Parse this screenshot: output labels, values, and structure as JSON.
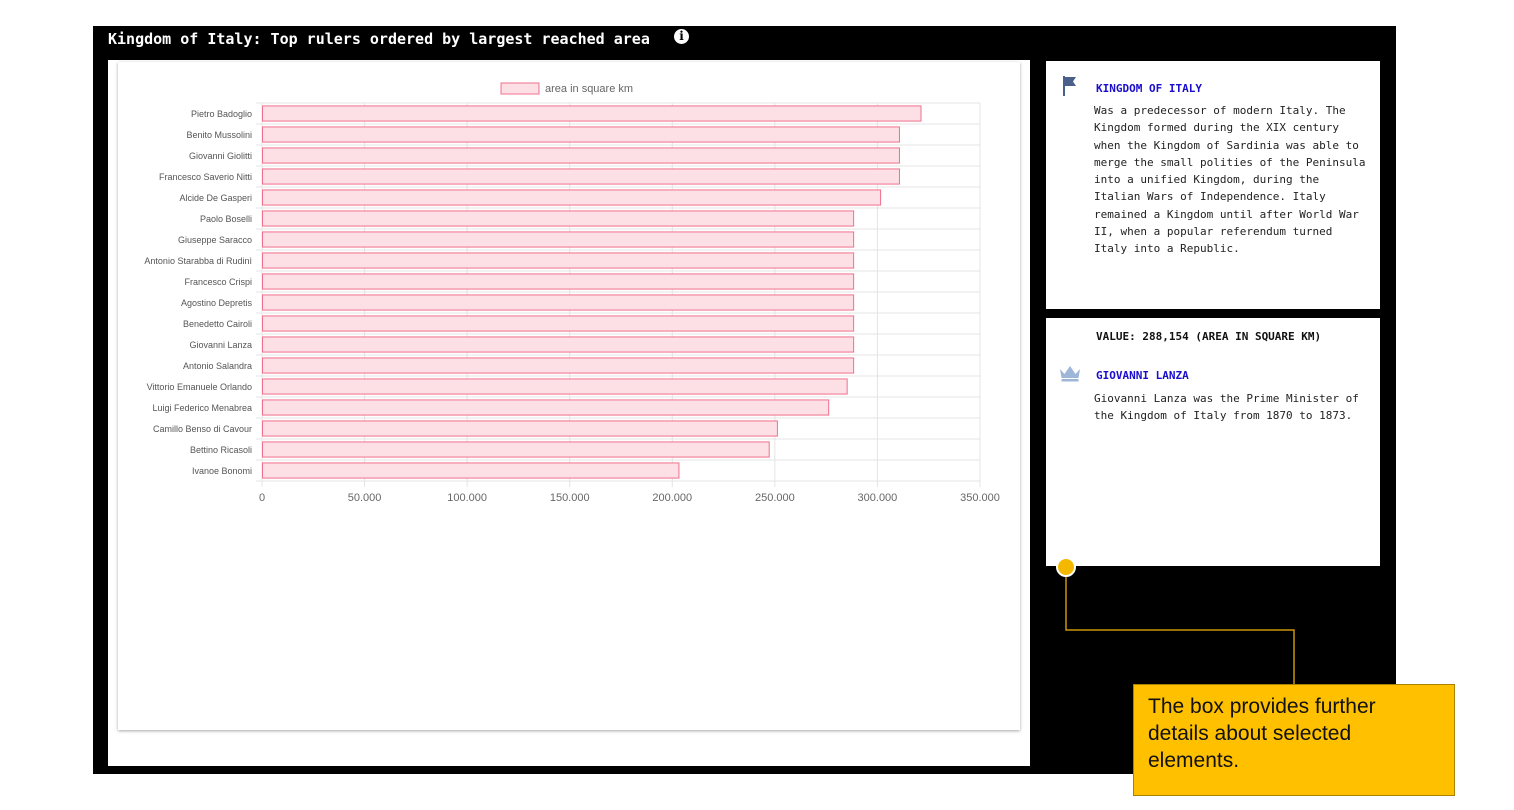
{
  "page": {
    "title": "Kingdom of Italy: Top rulers ordered by largest reached area",
    "info_icon": "info-icon"
  },
  "kingdom_panel": {
    "icon": "flag-icon",
    "heading": "KINGDOM OF ITALY",
    "description": "Was a predecessor of modern Italy. The Kingdom formed during the XIX century when the Kingdom of Sardinia was able to merge the small polities of the Peninsula into a unified Kingdom, during the Italian Wars of Independence. Italy remained a Kingdom until after World War II, when a popular referendum turned Italy into a Republic."
  },
  "detail_panel": {
    "value_text": "VALUE: 288,154 (AREA IN SQUARE KM)",
    "icon": "crown-icon",
    "heading": "GIOVANNI LANZA",
    "description": "Giovanni Lanza was the Prime Minister of the Kingdom of Italy from 1870 to 1873."
  },
  "callout": {
    "text": "The box provides further details about selected elements."
  },
  "colors": {
    "bar_fill": "#fde0e6",
    "bar_stroke": "#f0708c",
    "frame": "#000000",
    "link": "#1a0dcc",
    "callout": "#ffc000"
  },
  "chart_data": {
    "type": "bar",
    "orientation": "horizontal",
    "legend": "area in square km",
    "legend_position": "top",
    "grid": true,
    "xlim": [
      0,
      350000
    ],
    "x_ticks": [
      "0",
      "50.000",
      "100.000",
      "150.000",
      "200.000",
      "250.000",
      "300.000",
      "350.000"
    ],
    "categories": [
      "Pietro Badoglio",
      "Benito Mussolini",
      "Giovanni Giolitti",
      "Francesco Saverio Nitti",
      "Alcide De Gasperi",
      "Paolo Boselli",
      "Giuseppe Saracco",
      "Antonio Starabba di Rudinì",
      "Francesco Crispi",
      "Agostino Depretis",
      "Benedetto Cairoli",
      "Giovanni Lanza",
      "Antonio Salandra",
      "Vittorio Emanuele Orlando",
      "Luigi Federico Menabrea",
      "Camillo Benso di Cavour",
      "Bettino Ricasoli",
      "Ivanoe Bonomi"
    ],
    "values": [
      321000,
      310500,
      310500,
      310500,
      301300,
      288154,
      288154,
      288154,
      288154,
      288154,
      288154,
      288154,
      288154,
      285000,
      276000,
      251000,
      247000,
      203000
    ]
  }
}
